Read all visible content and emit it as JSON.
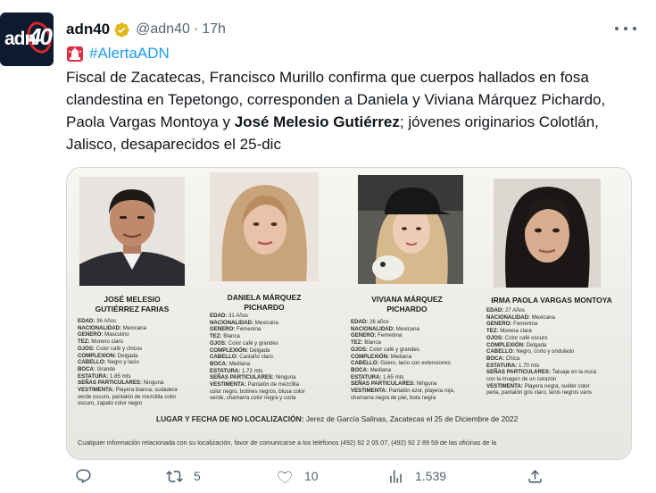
{
  "account": {
    "name": "adn40",
    "handle": "@adn40",
    "separator": "·",
    "time": "17h",
    "avatar_text_left": "adn",
    "avatar_text_right": "40"
  },
  "tweet": {
    "hashtag": "#AlertaADN",
    "text_part1": "Fiscal de Zacatecas, Francisco Murillo confirma que cuerpos hallados en fosa clandestina en Tepetongo, corresponden a Daniela y Viviana Márquez Pichardo, Paola Vargas Montoya y ",
    "text_bold": "José Melesio Gutiérrez",
    "text_part2": "; jóvenes originarios Colotlán, Jalisco, desaparecidos el 25-dic"
  },
  "poster": {
    "persons": [
      {
        "name_line1": "JOSÉ MELESIO",
        "name_line2": "GUTIÉRREZ FARIAS",
        "details": [
          {
            "k": "EDAD:",
            "v": "36 Años"
          },
          {
            "k": "NACIONALIDAD:",
            "v": "Mexicana"
          },
          {
            "k": "GENERO:",
            "v": "Masculino"
          },
          {
            "k": "TEZ:",
            "v": "Moreno claro"
          },
          {
            "k": "OJOS:",
            "v": "Color café y chicos"
          },
          {
            "k": "COMPLEXION:",
            "v": "Delgada"
          },
          {
            "k": "CABELLO:",
            "v": "Negro y lacio"
          },
          {
            "k": "BOCA:",
            "v": "Grande"
          },
          {
            "k": "ESTATURA:",
            "v": "1.85 mts"
          },
          {
            "k": "SEÑAS PARTICULARES:",
            "v": "Ninguna"
          },
          {
            "k": "VESTIMENTA:",
            "v": "Playera blanca, sudadera"
          },
          {
            "k": "",
            "v": "verde oscuro, pantalón de mezclilla color"
          },
          {
            "k": "",
            "v": "oscuro, zapato color negro"
          }
        ]
      },
      {
        "name_line1": "DANIELA MÁRQUEZ",
        "name_line2": "PICHARDO",
        "details": [
          {
            "k": "EDAD:",
            "v": "31 Años"
          },
          {
            "k": "NACIONALIDAD:",
            "v": "Mexicana"
          },
          {
            "k": "GENERO:",
            "v": "Femenina"
          },
          {
            "k": "TEZ:",
            "v": "Blanca"
          },
          {
            "k": "OJOS:",
            "v": "Color café y grandes"
          },
          {
            "k": "COMPLEXIÓN:",
            "v": "Delgada"
          },
          {
            "k": "CABELLO:",
            "v": "Castaño claro"
          },
          {
            "k": "BOCA:",
            "v": "Mediana"
          },
          {
            "k": "ESTATURA:",
            "v": "1.72 mts"
          },
          {
            "k": "SEÑAS PARTICULARES:",
            "v": "Ninguna"
          },
          {
            "k": "VESTIMENTA:",
            "v": "Pantalón de mezclilla"
          },
          {
            "k": "",
            "v": "color negro, botines negros, blusa color"
          },
          {
            "k": "",
            "v": "verde, chamarra color negra y corta"
          }
        ]
      },
      {
        "name_line1": "VIVIANA MÁRQUEZ",
        "name_line2": "PICHARDO",
        "details": [
          {
            "k": "EDAD:",
            "v": "26 años"
          },
          {
            "k": "NACIONALIDAD:",
            "v": "Mexicana"
          },
          {
            "k": "GENERO:",
            "v": "Femenina"
          },
          {
            "k": "TEZ:",
            "v": "Blanca"
          },
          {
            "k": "OJOS:",
            "v": "Color café y grandes"
          },
          {
            "k": "COMPLEXIÓN:",
            "v": "Mediana"
          },
          {
            "k": "CABELLO:",
            "v": "Güero, lacio con extensiones"
          },
          {
            "k": "BOCA:",
            "v": "Mediana"
          },
          {
            "k": "ESTATURA:",
            "v": "1.65 mts"
          },
          {
            "k": "SEÑAS PARTICULARES:",
            "v": "Ninguna"
          },
          {
            "k": "VESTIMENTA:",
            "v": "Pantalón azul, playera roja,"
          },
          {
            "k": "",
            "v": "chamarra negra de piel, bota negra"
          }
        ]
      },
      {
        "name_line1": "IRMA PAOLA VARGAS MONTOYA",
        "name_line2": "",
        "details": [
          {
            "k": "EDAD:",
            "v": "27 Años"
          },
          {
            "k": "NACIONALIDAD:",
            "v": "Mexicana"
          },
          {
            "k": "GENERO:",
            "v": "Femenina"
          },
          {
            "k": "TEZ:",
            "v": "Morena clara"
          },
          {
            "k": "OJOS:",
            "v": "Color café oscuro"
          },
          {
            "k": "COMPLEXIÓN:",
            "v": "Delgada"
          },
          {
            "k": "CABELLO:",
            "v": "Negro, corto y ondulado"
          },
          {
            "k": "BOCA:",
            "v": "Chica"
          },
          {
            "k": "ESTATURA:",
            "v": "1.70 mts"
          },
          {
            "k": "SEÑAS PARTICULARES:",
            "v": "Tatuaje en la nuca"
          },
          {
            "k": "",
            "v": "con la imagen de un corazón"
          },
          {
            "k": "VESTIMENTA:",
            "v": "Playera negra, suéter color"
          },
          {
            "k": "",
            "v": "perla, pantalón gris claro, tenis negros vans"
          }
        ]
      }
    ],
    "location_label": "LUGAR Y FECHA DE NO LOCALIZACIÓN:",
    "location_value": "Jerez de García Salinas, Zacatecas el 25 de Diciembre de 2022",
    "footer": "Cualquier información relacionada con su localización, favor de comunicarse a los teléfonos (492) 92 2 05 07, (492) 92 2 89 59 de las oficinas de la"
  },
  "actions": {
    "reply_count": "",
    "retweet_count": "5",
    "like_count": "10",
    "views_count": "1.539"
  },
  "colors": {
    "link": "#1d9bf0",
    "secondary": "#536471",
    "verified": "#e2b719",
    "brand_red": "#d6252b",
    "brand_dark": "#0e1a2f"
  },
  "icons": [
    "verified-badge-icon",
    "siren-icon",
    "more-icon",
    "reply-icon",
    "retweet-icon",
    "like-icon",
    "views-icon",
    "share-icon"
  ]
}
